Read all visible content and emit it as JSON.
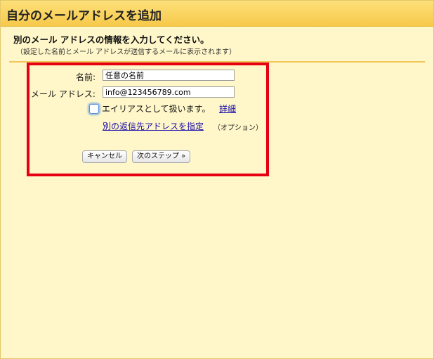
{
  "dialog": {
    "title": "自分のメールアドレスを追加",
    "heading": "別のメール アドレスの情報を入力してください。",
    "subheading": "（設定した名前とメール アドレスが送信するメールに表示されます）"
  },
  "form": {
    "name_label": "名前:",
    "name_value": "任意の名前",
    "email_label": "メール アドレス:",
    "email_value": "info@123456789.com",
    "alias_checkbox_label": "エイリアスとして扱います。",
    "alias_checked": false,
    "details_link": "詳細",
    "reply_to_link": "別の返信先アドレスを指定",
    "optional_note": "（オプション）"
  },
  "buttons": {
    "cancel": "キャンセル",
    "next": "次のステップ »"
  },
  "colors": {
    "title_bar": "#f7c94a",
    "background": "#fff7c9",
    "highlight_border": "#e60012",
    "link": "#1a0dab"
  }
}
